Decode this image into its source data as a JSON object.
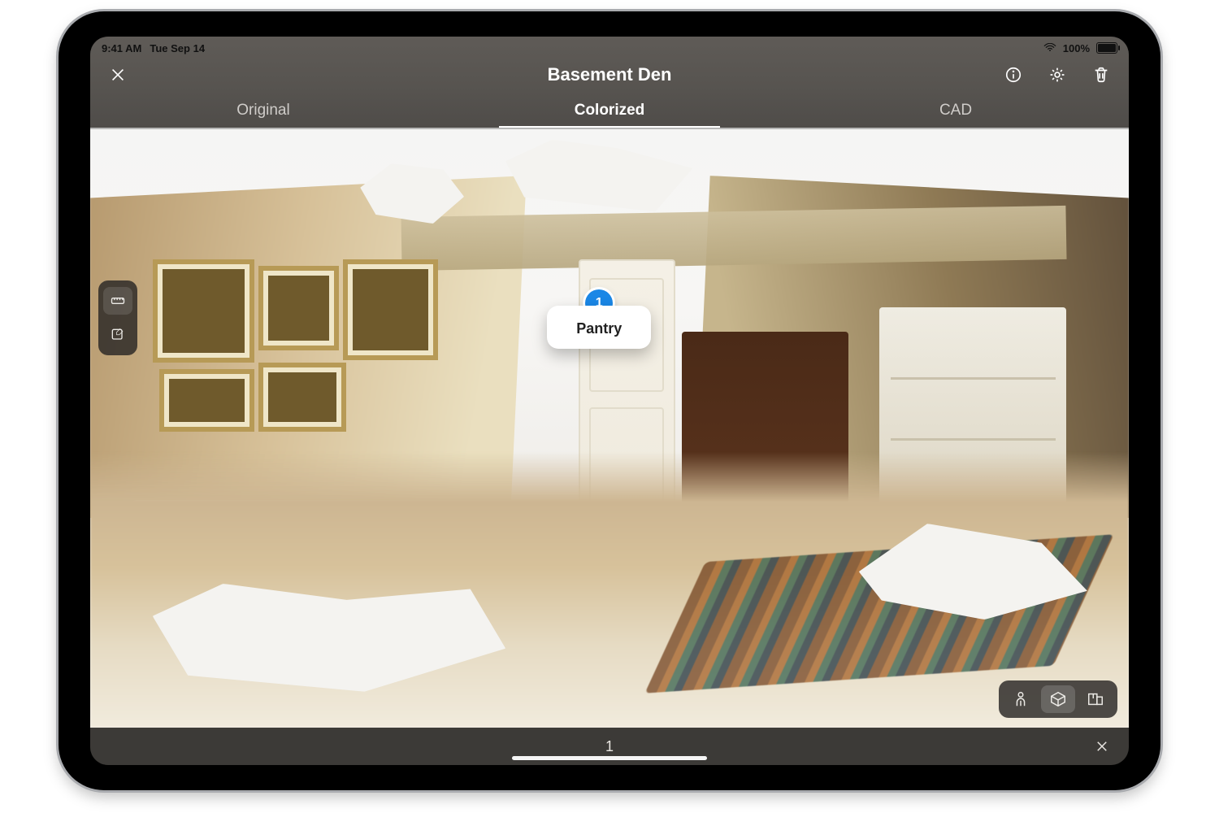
{
  "status": {
    "time": "9:41 AM",
    "date": "Tue Sep 14",
    "battery": "100%"
  },
  "header": {
    "title": "Basement Den",
    "tabs": [
      {
        "label": "Original",
        "active": false
      },
      {
        "label": "Colorized",
        "active": true
      },
      {
        "label": "CAD",
        "active": false
      }
    ]
  },
  "annotation": {
    "index": "1",
    "label": "Pantry"
  },
  "bottom": {
    "count": "1"
  }
}
